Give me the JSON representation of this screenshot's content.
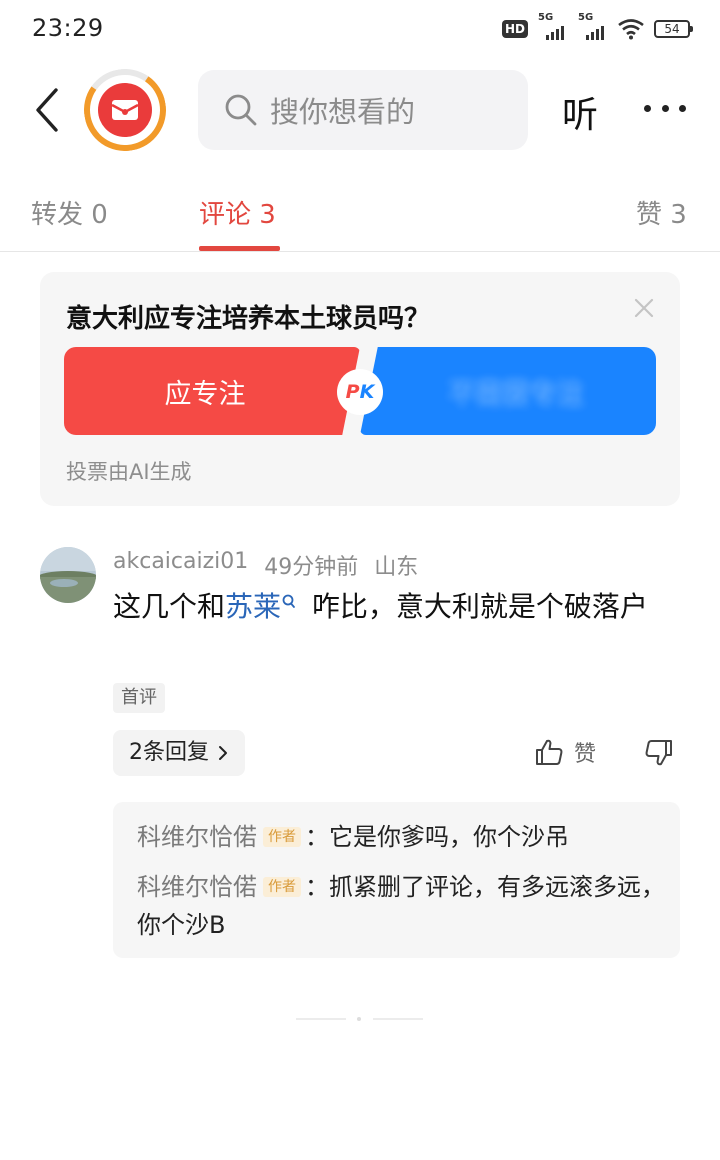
{
  "status_bar": {
    "time": "23:29",
    "hd_label": "HD",
    "signal_1_label": "5G",
    "signal_2_label": "5G",
    "battery_level": "54"
  },
  "header": {
    "search_placeholder": "搜你想看的",
    "listen_label": "听",
    "logo_color": "#ea3b3b",
    "logo_ring_color": "#f29a29"
  },
  "tabs": [
    {
      "label": "转发 0"
    },
    {
      "label": "评论 3"
    },
    {
      "label": "赞 3"
    }
  ],
  "active_tab_color": "#e2473f",
  "poll": {
    "question": "意大利应专注培养本土球员吗？",
    "option_left": "应专注",
    "option_right": "不需要专注",
    "pk_p": "P",
    "pk_k": "K",
    "footnote": "投票由AI生成",
    "left_color": "#f54a45",
    "right_color": "#1a84ff"
  },
  "comment": {
    "username": "akcaicaizi01",
    "time": "49分钟前",
    "location": "山东",
    "text_before": "这几个和",
    "link_text": "苏莱",
    "text_after": " 咋比，意大利就是个破落户",
    "first_badge": "首评",
    "replies_label": "2条回复",
    "like_label": "赞"
  },
  "replies": [
    {
      "author": "科维尔恰偌",
      "tag": "作者",
      "text": "：它是你爹吗，你个沙吊"
    },
    {
      "author": "科维尔恰偌",
      "tag": "作者",
      "text": "：抓紧删了评论，有多远滚多远，你个沙B"
    }
  ],
  "icons": {
    "back": "back-arrow-icon",
    "search": "search-icon",
    "more": "more-dots-icon",
    "close": "close-icon",
    "like": "thumbs-up-icon",
    "dislike": "thumbs-down-icon",
    "chevron": "chevron-right-icon",
    "link_search": "link-search-icon"
  }
}
